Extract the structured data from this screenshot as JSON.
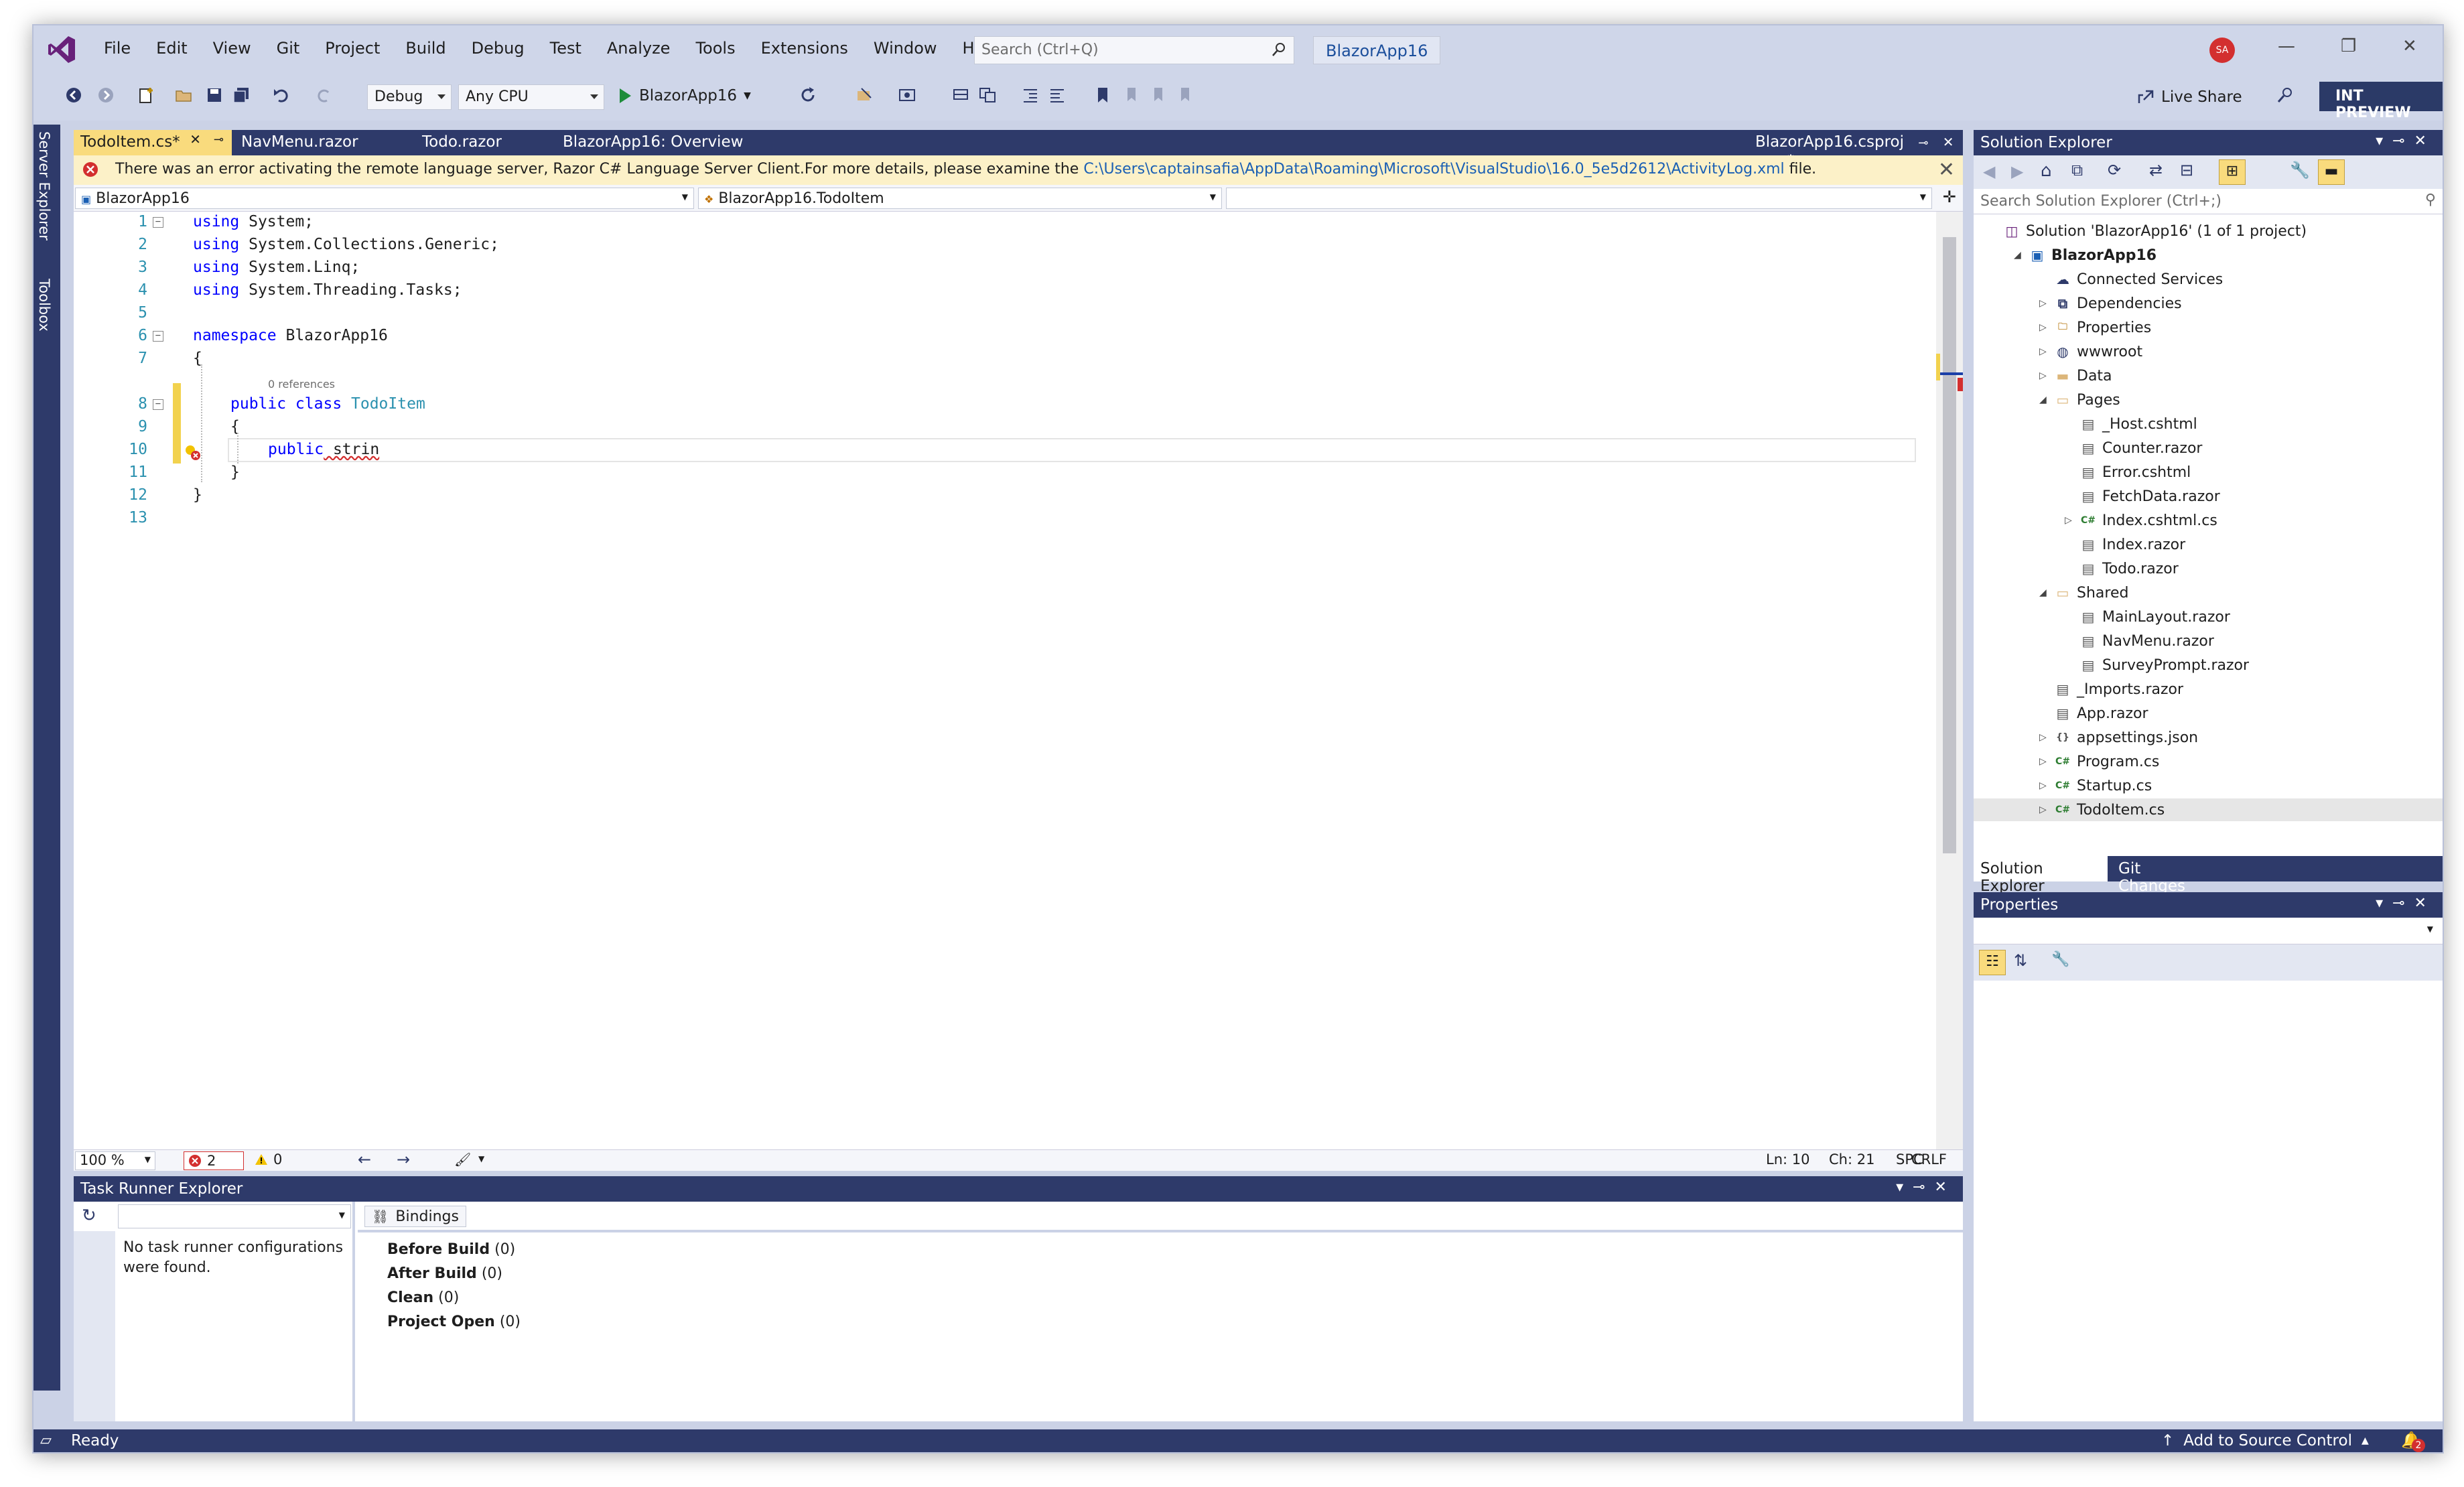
{
  "window": {
    "menu": [
      "File",
      "Edit",
      "View",
      "Git",
      "Project",
      "Build",
      "Debug",
      "Test",
      "Analyze",
      "Tools",
      "Extensions",
      "Window",
      "Help"
    ],
    "search_placeholder": "Search (Ctrl+Q)",
    "solution_chip": "BlazorApp16",
    "avatar_initials": "SA"
  },
  "toolbar": {
    "config": "Debug",
    "platform": "Any CPU",
    "run_target": "BlazorApp16",
    "live_share": "Live Share",
    "int_preview": "INT PREVIEW"
  },
  "left_rail": {
    "server_explorer": "Server Explorer",
    "toolbox": "Toolbox"
  },
  "editor": {
    "tabs": [
      {
        "label": "TodoItem.cs*",
        "active": true
      },
      {
        "label": "NavMenu.razor",
        "active": false
      },
      {
        "label": "Todo.razor",
        "active": false
      },
      {
        "label": "BlazorApp16: Overview",
        "active": false
      },
      {
        "label": "BlazorApp16.csproj",
        "active": false
      }
    ],
    "infobar": {
      "text": "There was an error activating the remote language server, Razor C# Language Server Client.For more details, please examine the ",
      "link": "C:\\Users\\captainsafia\\AppData\\Roaming\\Microsoft\\VisualStudio\\16.0_5e5d2612\\ActivityLog.xml",
      "suffix": " file."
    },
    "nav": {
      "project": "BlazorApp16",
      "type": "BlazorApp16.TodoItem",
      "member": ""
    },
    "line_numbers": [
      "1",
      "2",
      "3",
      "4",
      "5",
      "6",
      "7",
      "8",
      "9",
      "10",
      "11",
      "12",
      "13"
    ],
    "code": {
      "l1_kw": "using",
      "l1_rest": " System;",
      "l2_kw": "using",
      "l2_rest": " System.Collections.Generic;",
      "l3_kw": "using",
      "l3_rest": " System.Linq;",
      "l4_kw": "using",
      "l4_rest": " System.Threading.Tasks;",
      "l6_kw": "namespace",
      "l6_rest": " BlazorApp16",
      "l7": "{",
      "refs": "0 references",
      "l8_kw": "public class",
      "l8_type": " TodoItem",
      "l9": "{",
      "l10_kw": "public",
      "l10_rest": " strin",
      "l11": "}",
      "l12": "}"
    },
    "status": {
      "zoom": "100 %",
      "errors": "2",
      "warnings": "0",
      "ln": "Ln: 10",
      "ch": "Ch: 21",
      "spc": "SPC",
      "crlf": "CRLF"
    }
  },
  "solution_explorer": {
    "title": "Solution Explorer",
    "search_placeholder": "Search Solution Explorer (Ctrl+;)",
    "tree": [
      {
        "label": "Solution 'BlazorApp16' (1 of 1 project)",
        "indent": 0,
        "exp": "",
        "icon": "solution-icon",
        "bold": false
      },
      {
        "label": "BlazorApp16",
        "indent": 1,
        "exp": "◢",
        "icon": "project-icon",
        "bold": true
      },
      {
        "label": "Connected Services",
        "indent": 2,
        "exp": "",
        "icon": "connected-services-icon",
        "bold": false
      },
      {
        "label": "Dependencies",
        "indent": 2,
        "exp": "▷",
        "icon": "dependencies-icon",
        "bold": false
      },
      {
        "label": "Properties",
        "indent": 2,
        "exp": "▷",
        "icon": "properties-folder-icon",
        "bold": false
      },
      {
        "label": "wwwroot",
        "indent": 2,
        "exp": "▷",
        "icon": "globe-icon",
        "bold": false
      },
      {
        "label": "Data",
        "indent": 2,
        "exp": "▷",
        "icon": "folder-icon",
        "bold": false
      },
      {
        "label": "Pages",
        "indent": 2,
        "exp": "◢",
        "icon": "folder-open-icon",
        "bold": false
      },
      {
        "label": "_Host.cshtml",
        "indent": 3,
        "exp": "",
        "icon": "file-icon",
        "bold": false
      },
      {
        "label": "Counter.razor",
        "indent": 3,
        "exp": "",
        "icon": "file-icon",
        "bold": false
      },
      {
        "label": "Error.cshtml",
        "indent": 3,
        "exp": "",
        "icon": "file-icon",
        "bold": false
      },
      {
        "label": "FetchData.razor",
        "indent": 3,
        "exp": "",
        "icon": "file-icon",
        "bold": false
      },
      {
        "label": "Index.cshtml.cs",
        "indent": 3,
        "exp": "▷",
        "icon": "csharp-file-icon",
        "bold": false
      },
      {
        "label": "Index.razor",
        "indent": 3,
        "exp": "",
        "icon": "file-icon",
        "bold": false
      },
      {
        "label": "Todo.razor",
        "indent": 3,
        "exp": "",
        "icon": "file-icon",
        "bold": false
      },
      {
        "label": "Shared",
        "indent": 2,
        "exp": "◢",
        "icon": "folder-open-icon",
        "bold": false
      },
      {
        "label": "MainLayout.razor",
        "indent": 3,
        "exp": "",
        "icon": "file-icon",
        "bold": false
      },
      {
        "label": "NavMenu.razor",
        "indent": 3,
        "exp": "",
        "icon": "file-icon",
        "bold": false
      },
      {
        "label": "SurveyPrompt.razor",
        "indent": 3,
        "exp": "",
        "icon": "file-icon",
        "bold": false
      },
      {
        "label": "_Imports.razor",
        "indent": 2,
        "exp": "",
        "icon": "file-icon",
        "bold": false
      },
      {
        "label": "App.razor",
        "indent": 2,
        "exp": "",
        "icon": "file-icon",
        "bold": false
      },
      {
        "label": "appsettings.json",
        "indent": 2,
        "exp": "▷",
        "icon": "json-file-icon",
        "bold": false
      },
      {
        "label": "Program.cs",
        "indent": 2,
        "exp": "▷",
        "icon": "csharp-file-icon",
        "bold": false
      },
      {
        "label": "Startup.cs",
        "indent": 2,
        "exp": "▷",
        "icon": "csharp-file-icon",
        "bold": false
      },
      {
        "label": "TodoItem.cs",
        "indent": 2,
        "exp": "▷",
        "icon": "csharp-file-icon",
        "bold": false,
        "selected": true
      }
    ],
    "bottom_tabs": [
      "Solution Explorer",
      "Git Changes"
    ]
  },
  "properties": {
    "title": "Properties"
  },
  "task_runner": {
    "title": "Task Runner Explorer",
    "empty_text": "No task runner configurations were found.",
    "bindings_tab": "Bindings",
    "bindings": [
      {
        "label": "Before Build",
        "count": "(0)"
      },
      {
        "label": "After Build",
        "count": "(0)"
      },
      {
        "label": "Clean",
        "count": "(0)"
      },
      {
        "label": "Project Open",
        "count": "(0)"
      }
    ]
  },
  "statusbar": {
    "ready": "Ready",
    "source_control": "Add to Source Control",
    "notifications": "2"
  },
  "colors": {
    "chrome": "#cbd2e6",
    "dark": "#2e3a6a",
    "accent_tab": "#f9db7d",
    "keyword": "#0000ff",
    "type": "#2b91af",
    "error": "#d32f2f"
  }
}
